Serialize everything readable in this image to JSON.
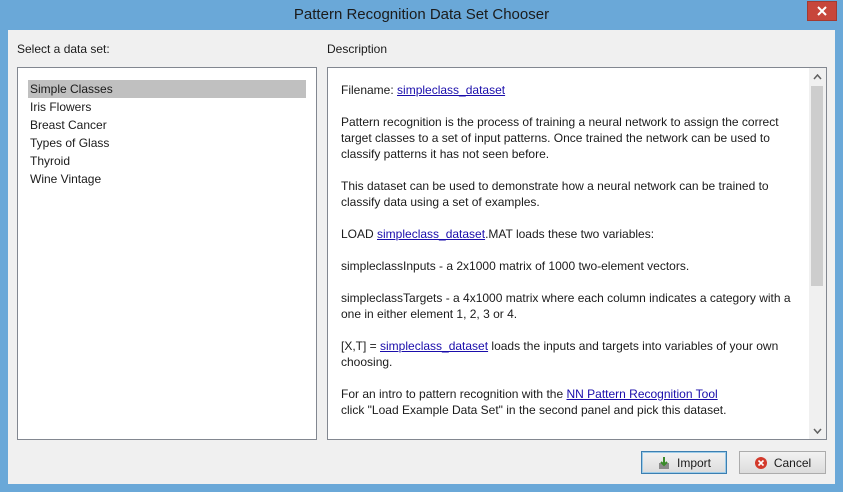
{
  "window": {
    "title": "Pattern Recognition Data Set Chooser"
  },
  "left_panel": {
    "label": "Select a data set:",
    "items": [
      {
        "label": "Simple Classes",
        "selected": true
      },
      {
        "label": "Iris Flowers",
        "selected": false
      },
      {
        "label": "Breast Cancer",
        "selected": false
      },
      {
        "label": "Types of Glass",
        "selected": false
      },
      {
        "label": "Thyroid",
        "selected": false
      },
      {
        "label": "Wine Vintage",
        "selected": false
      }
    ]
  },
  "right_panel": {
    "label": "Description",
    "filename_prefix": "Filename: ",
    "filename_link": "simpleclass_dataset",
    "para1": "Pattern recognition is the process of training a neural network to assign the correct target classes to a set of input patterns. Once trained the network can be used to classify patterns it has not seen before.",
    "para2": "This dataset can be used to demonstrate how a neural network can be trained to classify data using a set of examples.",
    "para3_prefix": "LOAD ",
    "para3_link": "simpleclass_dataset",
    "para3_suffix": ".MAT loads these two variables:",
    "para4": "simpleclassInputs - a 2x1000 matrix of 1000 two-element vectors.",
    "para5": "simpleclassTargets - a 4x1000 matrix where each column indicates a category with a one in either element 1, 2, 3 or 4.",
    "para6_prefix": "[X,T] = ",
    "para6_link": "simpleclass_dataset",
    "para6_suffix": " loads the inputs and targets into variables of your own choosing.",
    "para7_prefix": "For an intro to pattern recognition with the ",
    "para7_link": "NN Pattern Recognition Tool",
    "para7_suffix": "click \"Load Example Data Set\" in the second panel and pick this dataset."
  },
  "buttons": {
    "import_label": "Import",
    "cancel_label": "Cancel"
  },
  "colors": {
    "titlebar": "#6aa8d8",
    "close": "#c7463b",
    "selection": "#c0c0c0",
    "link": "#1a0dab"
  }
}
